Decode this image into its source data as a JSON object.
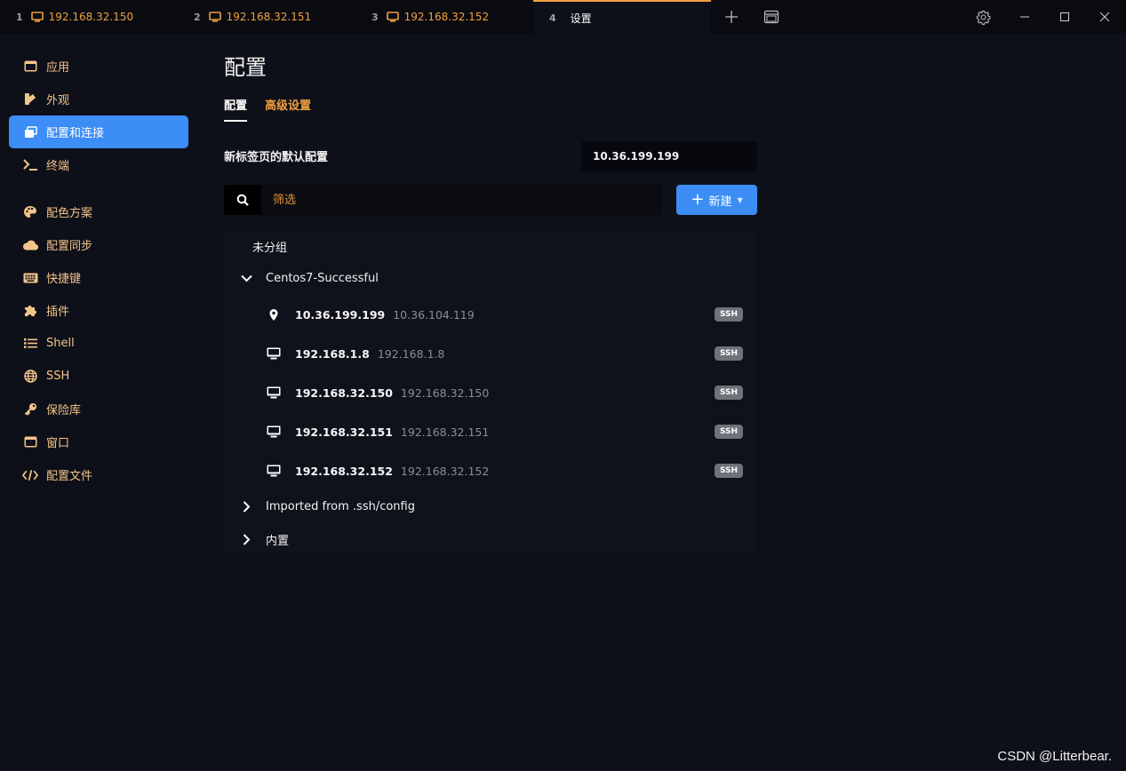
{
  "tabs": [
    {
      "num": "1",
      "label": "192.168.32.150",
      "icon": "monitor-icon"
    },
    {
      "num": "2",
      "label": "192.168.32.151",
      "icon": "monitor-icon"
    },
    {
      "num": "3",
      "label": "192.168.32.152",
      "icon": "monitor-icon"
    },
    {
      "num": "4",
      "label": "设置"
    }
  ],
  "sidebar": {
    "items": [
      {
        "label": "应用",
        "icon": "window-icon"
      },
      {
        "label": "外观",
        "icon": "swatches-icon"
      },
      {
        "label": "配置和连接",
        "icon": "windows-stack-icon",
        "active": true
      },
      {
        "label": "终端",
        "icon": "terminal-icon"
      },
      {
        "label": "配色方案",
        "icon": "palette-icon"
      },
      {
        "label": "配置同步",
        "icon": "cloud-icon"
      },
      {
        "label": "快捷键",
        "icon": "keyboard-icon"
      },
      {
        "label": "插件",
        "icon": "puzzle-icon"
      },
      {
        "label": "Shell",
        "icon": "list-icon"
      },
      {
        "label": "SSH",
        "icon": "globe-icon"
      },
      {
        "label": "保险库",
        "icon": "key-icon"
      },
      {
        "label": "窗口",
        "icon": "window-icon"
      },
      {
        "label": "配置文件",
        "icon": "code-icon"
      }
    ]
  },
  "main": {
    "title": "配置",
    "subtabs": [
      {
        "label": "配置",
        "active": true
      },
      {
        "label": "高级设置"
      }
    ],
    "default_label": "新标签页的默认配置",
    "default_value": "10.36.199.199",
    "search_placeholder": "筛选",
    "new_button": "新建",
    "groups": [
      {
        "label": "未分组"
      },
      {
        "label": "Centos7-Successful",
        "expanded": true,
        "profiles": [
          {
            "name": "10.36.199.199",
            "host": "10.36.104.119",
            "badge": "SSH",
            "icon": "map-pin-icon"
          },
          {
            "name": "192.168.1.8",
            "host": "192.168.1.8",
            "badge": "SSH",
            "icon": "desktop-icon"
          },
          {
            "name": "192.168.32.150",
            "host": "192.168.32.150",
            "badge": "SSH",
            "icon": "desktop-icon"
          },
          {
            "name": "192.168.32.151",
            "host": "192.168.32.151",
            "badge": "SSH",
            "icon": "desktop-icon"
          },
          {
            "name": "192.168.32.152",
            "host": "192.168.32.152",
            "badge": "SSH",
            "icon": "desktop-icon"
          }
        ]
      },
      {
        "label": "Imported from .ssh/config",
        "expanded": false
      },
      {
        "label": "内置",
        "expanded": false
      }
    ]
  },
  "watermark": "CSDN @Litterbear.",
  "colors": {
    "accent": "#f0a040",
    "primary": "#3c8df5",
    "background": "#0e1019"
  }
}
